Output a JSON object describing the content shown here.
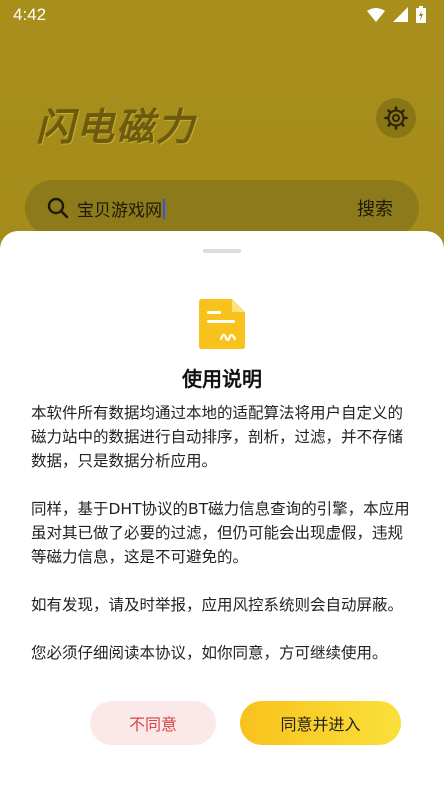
{
  "status_bar": {
    "time": "4:42"
  },
  "app": {
    "title": "闪电磁力"
  },
  "search": {
    "value": "宝贝游戏网",
    "button_label": "搜索"
  },
  "dialog": {
    "title": "使用说明",
    "paragraphs": [
      "本软件所有数据均通过本地的适配算法将用户自定义的磁力站中的数据进行自动排序，剖析，过滤，并不存储数据，只是数据分析应用。",
      "同样，基于DHT协议的BT磁力信息查询的引擎，本应用虽对其已做了必要的过滤，但仍可能会出现虚假，违规等磁力信息，这是不可避免的。",
      "如有发现，请及时举报，应用风控系统则会自动屏蔽。",
      "您必须仔细阅读本协议，如你同意，方可继续使用。"
    ],
    "disagree_label": "不同意",
    "agree_label": "同意并进入"
  },
  "colors": {
    "accent": "#f7c21b",
    "disagree_text": "#d64545",
    "disagree_bg": "#fbe9e9"
  }
}
